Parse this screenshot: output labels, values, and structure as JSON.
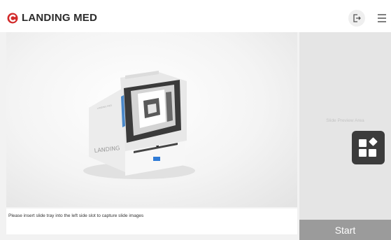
{
  "header": {
    "brand": "LANDING MED",
    "brand_color": "#d22a2a",
    "exit_icon": "exit-icon",
    "menu_icon": "hamburger-menu-icon"
  },
  "main": {
    "image_description_icon": "slide-scanner-device-image",
    "instruction": "Please insert slide tray into the left side slot to capture slide images"
  },
  "preview": {
    "label": "Slide Preview Area",
    "icon": "apps-grid-icon"
  },
  "actions": {
    "start_label": "Start",
    "start_color": "#9b9b9b"
  }
}
